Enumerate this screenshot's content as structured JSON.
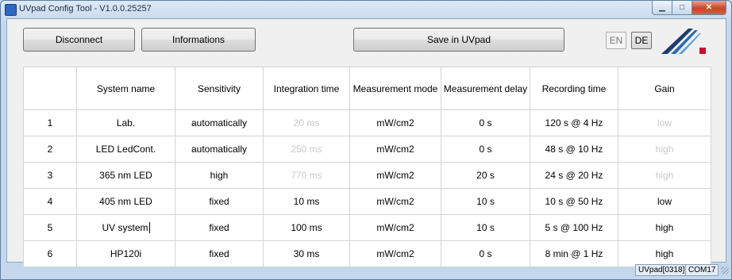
{
  "window": {
    "title": "UVpad Config Tool - V1.0.0.25257"
  },
  "toolbar": {
    "disconnect_label": "Disconnect",
    "informations_label": "Informations",
    "save_label": "Save in UVpad",
    "lang_en": "EN",
    "lang_de": "DE"
  },
  "table": {
    "headers": [
      "",
      "System name",
      "Sensitivity",
      "Integration time",
      "Measurement mode",
      "Measurement delay",
      "Recording time",
      "Gain"
    ],
    "rows": [
      {
        "index": "1",
        "name": "Lab.",
        "sensitivity": "automatically",
        "integration": "20 ms",
        "mode": "mW/cm2",
        "delay": "0 s",
        "recording": "120 s @   4 Hz",
        "gain": "low"
      },
      {
        "index": "2",
        "name": "LED LedCont.",
        "sensitivity": "automatically",
        "integration": "250 ms",
        "mode": "mW/cm2",
        "delay": "0 s",
        "recording": "48 s @  10 Hz",
        "gain": "high"
      },
      {
        "index": "3",
        "name": "365 nm LED",
        "sensitivity": "high",
        "integration": "770 ms",
        "mode": "mW/cm2",
        "delay": "20 s",
        "recording": "24 s @  20 Hz",
        "gain": "high"
      },
      {
        "index": "4",
        "name": "405 nm LED",
        "sensitivity": "fixed",
        "integration": "10 ms",
        "mode": "mW/cm2",
        "delay": "10 s",
        "recording": "10 s @  50 Hz",
        "gain": "low"
      },
      {
        "index": "5",
        "name": "UV system",
        "sensitivity": "fixed",
        "integration": "100 ms",
        "mode": "mW/cm2",
        "delay": "10 s",
        "recording": "5 s @ 100 Hz",
        "gain": "high"
      },
      {
        "index": "6",
        "name": "HP120i",
        "sensitivity": "fixed",
        "integration": "30 ms",
        "mode": "mW/cm2",
        "delay": "0 s",
        "recording": "8 min @   1 Hz",
        "gain": "high"
      }
    ]
  },
  "status": {
    "device": "UVpad[0318]",
    "port": "COM17"
  },
  "colors": {
    "logo_blue": "#2b6cb0",
    "logo_dark": "#1d3d6e",
    "logo_red": "#c8102e"
  }
}
